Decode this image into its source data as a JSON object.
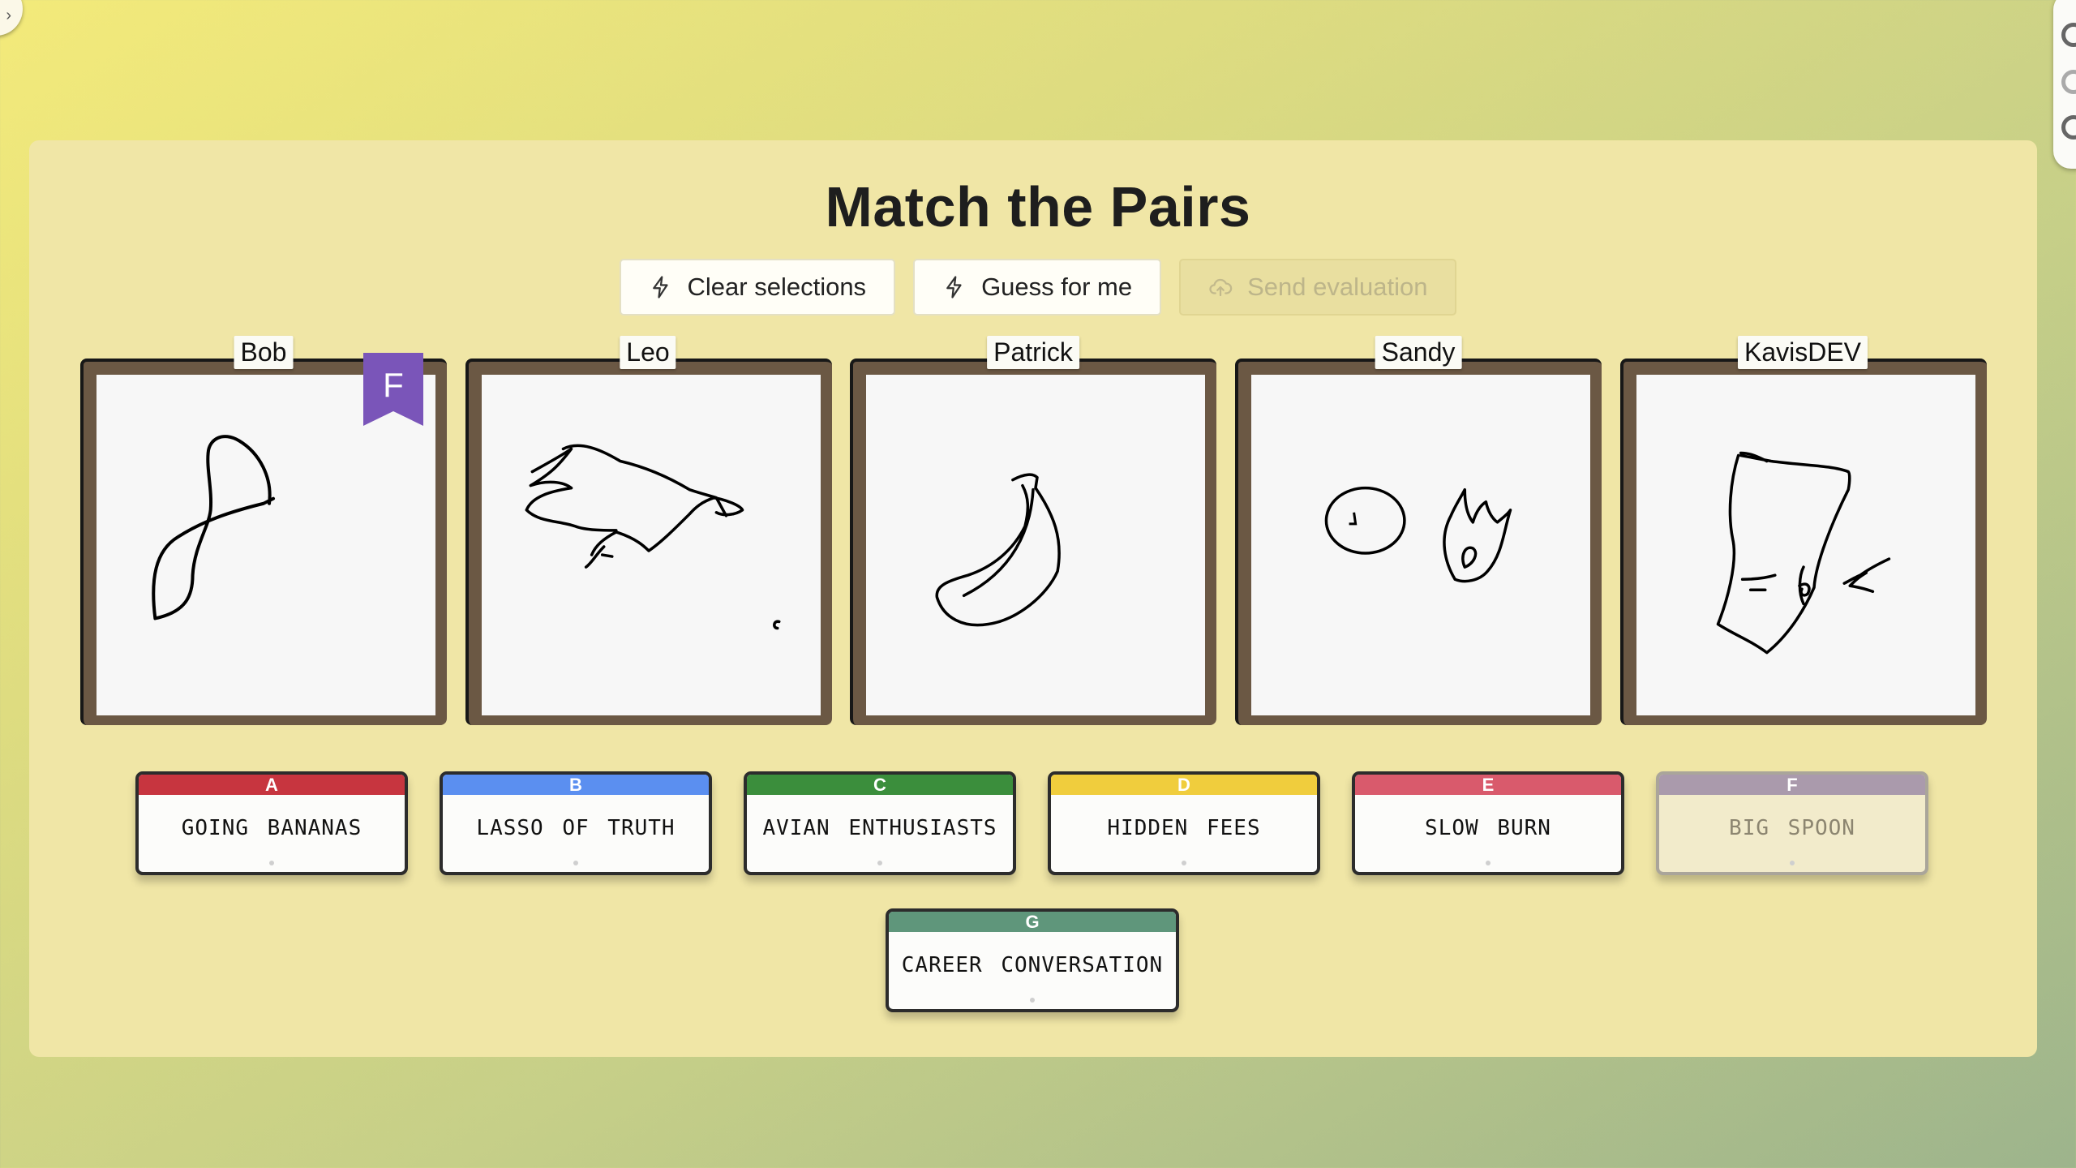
{
  "title": "Match the Pairs",
  "toolbar": {
    "clear": "Clear selections",
    "guess": "Guess for me",
    "send": "Send evaluation"
  },
  "drawings": [
    {
      "player": "Bob",
      "assigned": "F"
    },
    {
      "player": "Leo"
    },
    {
      "player": "Patrick"
    },
    {
      "player": "Sandy"
    },
    {
      "player": "KavisDEV"
    }
  ],
  "categories": [
    {
      "letter": "A",
      "label": "GOING BANANAS",
      "color": "#c7353f"
    },
    {
      "letter": "B",
      "label": "LASSO OF TRUTH",
      "color": "#5b8ff0"
    },
    {
      "letter": "C",
      "label": "AVIAN ENTHUSIASTS",
      "color": "#3b8e3c"
    },
    {
      "letter": "D",
      "label": "HIDDEN FEES",
      "color": "#f0cd3d"
    },
    {
      "letter": "E",
      "label": "SLOW BURN",
      "color": "#d95a6c"
    },
    {
      "letter": "F",
      "label": "BIG SPOON",
      "color": "#aa9aac",
      "used": true
    },
    {
      "letter": "G",
      "label": "CAREER CONVERSATION",
      "color": "#5f967b"
    }
  ],
  "colors": {
    "background_top": "#f3ea7a",
    "panel": "#f0e6a6",
    "assigned_flag": "#7a55b9"
  }
}
